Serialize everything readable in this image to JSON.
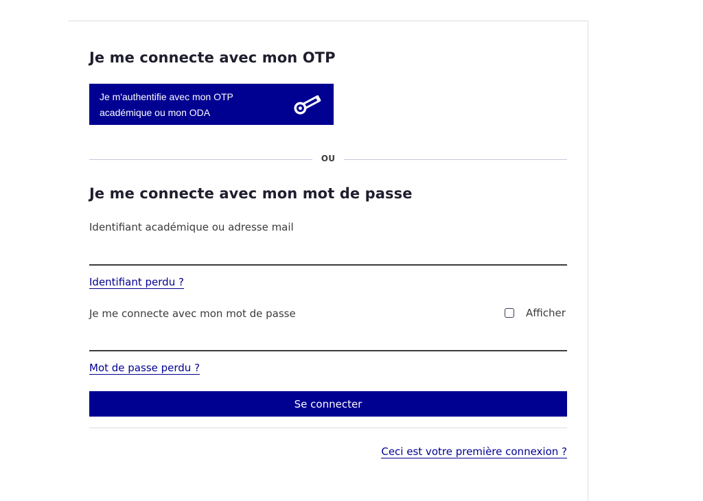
{
  "otp_section": {
    "title": "Je me connecte avec mon OTP",
    "button_line1": "Je m'authentifie avec mon OTP",
    "button_line2": "académique ou mon ODA",
    "icon": "otp-key-icon"
  },
  "divider": {
    "label": "OU"
  },
  "password_section": {
    "title": "Je me connecte avec mon mot de passe",
    "identifier_label": "Identifiant académique ou adresse mail",
    "identifier_value": "",
    "identifier_lost_link": "Identifiant perdu ?",
    "password_label": "Je me connecte avec mon mot de passe",
    "password_value": "",
    "show_password_label": "Afficher",
    "show_password_checked": false,
    "password_lost_link": "Mot de passe perdu ?",
    "submit_label": "Se connecter",
    "first_login_link": "Ceci est votre première connexion ?"
  },
  "colors": {
    "primary": "#000091",
    "text": "#3a3a3a",
    "heading": "#1e1e2e"
  }
}
